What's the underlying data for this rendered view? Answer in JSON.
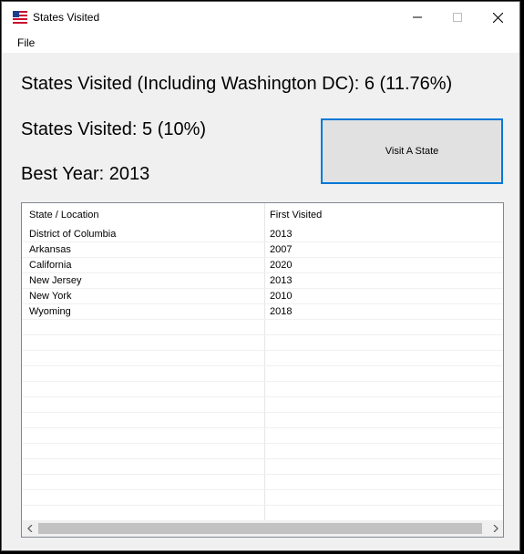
{
  "window": {
    "title": "States Visited",
    "icon": "us-flag-icon"
  },
  "menu": {
    "file_label": "File"
  },
  "stats": {
    "including_dc": "States Visited (Including Washington DC): 6 (11.76%)",
    "states_only": "States Visited: 5 (10%)",
    "best_year": "Best Year: 2013"
  },
  "actions": {
    "visit_label": "Visit A State"
  },
  "table": {
    "columns": [
      "State / Location",
      "First Visited"
    ],
    "rows": [
      [
        "District of Columbia",
        "2013"
      ],
      [
        "Arkansas",
        "2007"
      ],
      [
        "California",
        "2020"
      ],
      [
        "New Jersey",
        "2013"
      ],
      [
        "New York",
        "2010"
      ],
      [
        "Wyoming",
        "2018"
      ],
      [
        "",
        ""
      ],
      [
        "",
        ""
      ],
      [
        "",
        ""
      ],
      [
        "",
        ""
      ],
      [
        "",
        ""
      ],
      [
        "",
        ""
      ],
      [
        "",
        ""
      ],
      [
        "",
        ""
      ],
      [
        "",
        ""
      ],
      [
        "",
        ""
      ],
      [
        "",
        ""
      ],
      [
        "",
        ""
      ],
      [
        "",
        ""
      ]
    ]
  },
  "colors": {
    "accent": "#0078d7",
    "window_bg": "#f0f0f0"
  }
}
